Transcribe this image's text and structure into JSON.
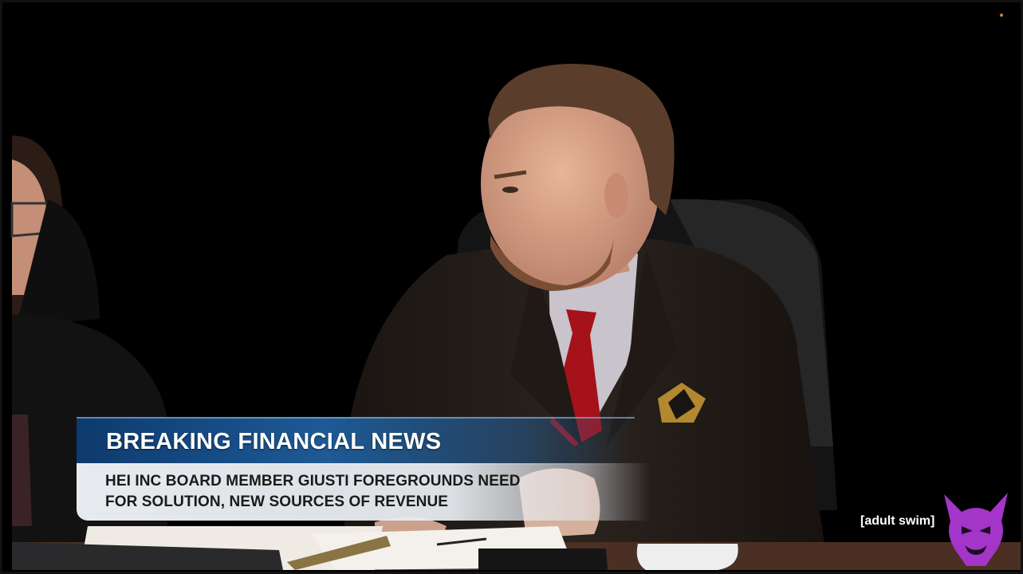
{
  "lower_third": {
    "title": "BREAKING FINANCIAL NEWS",
    "headline_line1": "HEI INC BOARD MEMBER GIUSTI FOREGROUNDS NEED",
    "headline_line2": "FOR SOLUTION, NEW SOURCES OF REVENUE",
    "header_color": "#1e5a96",
    "body_color": "#eef1f5"
  },
  "network_bug": {
    "label": "[adult swim]",
    "logo_icon": "purple-demon-icon",
    "logo_color": "#a335c9"
  }
}
